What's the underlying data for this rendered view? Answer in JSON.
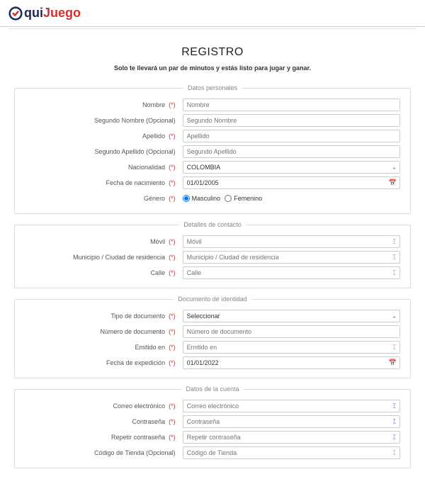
{
  "logo": {
    "aqui": "qui",
    "juego": "Juego"
  },
  "title": "REGISTRO",
  "subtitle": "Solo te llevará un par de minutos y estás listo para jugar y ganar.",
  "required_mark": "(*)",
  "sections": {
    "personal": {
      "legend": "Datos personales",
      "nombre_label": "Nombre",
      "nombre_ph": "Nombre",
      "segundo_nombre_label": "Segundo Nombre (Opcional)",
      "segundo_nombre_ph": "Segundo Nombre",
      "apellido_label": "Apellido",
      "apellido_ph": "Apellido",
      "segundo_apellido_label": "Segundo Apellido (Opcional)",
      "segundo_apellido_ph": "Segundo Apellido",
      "nacionalidad_label": "Nacionalidad",
      "nacionalidad_value": "COLOMBIA",
      "fecha_nac_label": "Fecha de nacimiento",
      "fecha_nac_value": "01/01/2005",
      "genero_label": "Género",
      "genero_m": "Masculino",
      "genero_f": "Femenino"
    },
    "contacto": {
      "legend": "Detalles de contacto",
      "movil_label": "Móvil",
      "movil_ph": "Móvil",
      "municipio_label": "Municipio / Ciudad de residencia",
      "municipio_ph": "Municipio / Ciudad de residencia",
      "calle_label": "Calle",
      "calle_ph": "Calle"
    },
    "documento": {
      "legend": "Documento de identidad",
      "tipo_label": "Tipo de documento",
      "tipo_value": "Seleccionar",
      "numero_label": "Número de documento",
      "numero_ph": "Número de documento",
      "emitido_label": "Emitido en",
      "emitido_ph": "Emitido en",
      "fecha_exp_label": "Fecha de expedición",
      "fecha_exp_value": "01/01/2022"
    },
    "cuenta": {
      "legend": "Datos de la cuenta",
      "correo_label": "Correo electrónico",
      "correo_ph": "Correo electrónico",
      "contrasena_label": "Contraseña",
      "contrasena_ph": "Contraseña",
      "repetir_label": "Repetir contraseña",
      "repetir_ph": "Repetir contraseña",
      "codigo_label": "Código de Tienda (Opcional)",
      "codigo_ph": "Código de Tienda"
    }
  }
}
